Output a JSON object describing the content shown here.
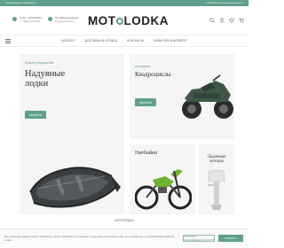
{
  "topbar": {
    "left_text": "Аренда/кредит информация",
    "right_text": "Обработка персональных данных"
  },
  "header": {
    "hours": "10:00 – 20:00 (МСК)",
    "phone": "+7 (999) 000-00-00",
    "contact_title": "По любым вопросам",
    "contact_email": "info@motolodka.ru",
    "logo_pre": "MOT",
    "logo_post": "LODKA"
  },
  "nav": {
    "items": [
      "Каталог",
      "Доставка и оплата",
      "Контакты",
      "Гарантия и возврат"
    ]
  },
  "cards": {
    "boats": {
      "tag": "Лучшее предложение",
      "title_line1": "Надувные",
      "title_line2": "лодки",
      "button": "Перейти"
    },
    "atv": {
      "tag": "для отдыха",
      "title": "Квадроциклы",
      "button": "Перейти"
    },
    "dirtbike": {
      "title": "Питбайки"
    },
    "motors": {
      "title_line1": "Лодочные",
      "title_line2": "моторы"
    }
  },
  "section": {
    "title": "Мотолодки"
  },
  "cookie": {
    "text": "Мы используем файлы cookie. Подробнее о целях обработки в соглашении. Продолжая использовать сайт, вы соглашаетесь с использованием файлов cookie.",
    "policy_button": "Политика конфиденциальности",
    "accept_button": "Принять"
  },
  "colors": {
    "accent": "#5f9f8d",
    "card_bg": "#f4f5f4",
    "text": "#333333"
  }
}
